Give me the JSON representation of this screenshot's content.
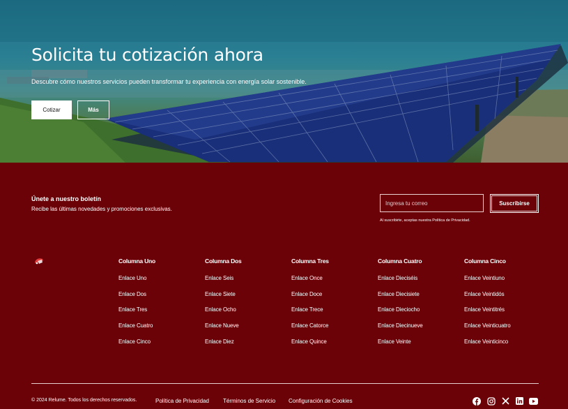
{
  "hero": {
    "title": "Solicita tu cotización ahora",
    "subtitle": "Descubre cómo nuestros servicios pueden transformar tu experiencia con energía solar sostenible.",
    "primary_button": "Cotizar",
    "secondary_button": "Más"
  },
  "newsletter": {
    "title": "Únete a nuestro boletín",
    "subtitle": "Recibe las últimas novedades y promociones exclusivas.",
    "email_placeholder": "Ingresa tu correo",
    "subscribe_button": "Suscribirse",
    "note": "Al suscribirte, aceptas nuestra Política de Privacidad."
  },
  "logo_icon": "brand-logo-icon",
  "columns": [
    {
      "title": "Columna Uno",
      "links": [
        "Enlace Uno",
        "Enlace Dos",
        "Enlace Tres",
        "Enlace Cuatro",
        "Enlace Cinco"
      ]
    },
    {
      "title": "Columna Dos",
      "links": [
        "Enlace Seis",
        "Enlace Siete",
        "Enlace Ocho",
        "Enlace Nueve",
        "Enlace Diez"
      ]
    },
    {
      "title": "Columna Tres",
      "links": [
        "Enlace Once",
        "Enlace Doce",
        "Enlace Trece",
        "Enlace Catorce",
        "Enlace Quince"
      ]
    },
    {
      "title": "Columna Cuatro",
      "links": [
        "Enlace Dieciséis",
        "Enlace Diecisiete",
        "Enlace Dieciocho",
        "Enlace Diecinueve",
        "Enlace Veinte"
      ]
    },
    {
      "title": "Columna Cinco",
      "links": [
        "Enlace Veintiuno",
        "Enlace Veintidós",
        "Enlace Veintitrés",
        "Enlace Veinticuatro",
        "Enlace Veinticinco"
      ]
    }
  ],
  "footer": {
    "copyright": "© 2024 Relume. Todos los derechos reservados.",
    "legal_links": [
      "Política de Privacidad",
      "Términos de Servicio",
      "Configuración de Cookies"
    ],
    "social_icons": [
      "facebook-icon",
      "instagram-icon",
      "x-icon",
      "linkedin-icon",
      "youtube-icon"
    ]
  },
  "colors": {
    "footer_background": "#6b0208",
    "text": "#ffffff",
    "solar_panel": "#1a2f7a"
  }
}
